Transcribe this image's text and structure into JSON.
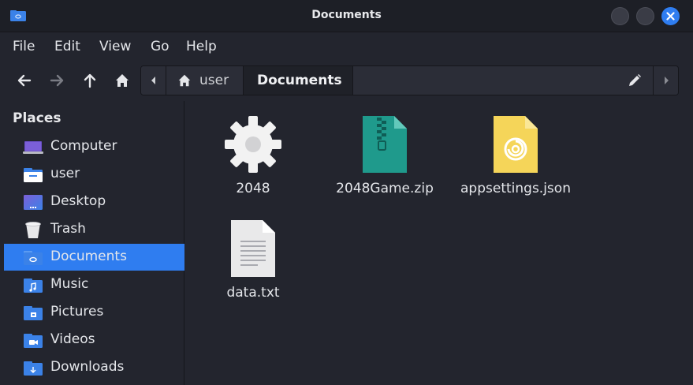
{
  "window": {
    "title": "Documents"
  },
  "menu": [
    "File",
    "Edit",
    "View",
    "Go",
    "Help"
  ],
  "path": {
    "home": "user",
    "current": "Documents"
  },
  "sidebar": {
    "heading": "Places",
    "items": [
      {
        "label": "Computer",
        "icon": "computer-icon"
      },
      {
        "label": "user",
        "icon": "home-folder-icon"
      },
      {
        "label": "Desktop",
        "icon": "desktop-folder-icon"
      },
      {
        "label": "Trash",
        "icon": "trash-icon"
      },
      {
        "label": "Documents",
        "icon": "documents-folder-icon",
        "active": true
      },
      {
        "label": "Music",
        "icon": "music-folder-icon"
      },
      {
        "label": "Pictures",
        "icon": "pictures-folder-icon"
      },
      {
        "label": "Videos",
        "icon": "videos-folder-icon"
      },
      {
        "label": "Downloads",
        "icon": "downloads-folder-icon"
      }
    ]
  },
  "files": [
    {
      "name": "2048",
      "icon": "executable-gear-icon"
    },
    {
      "name": "2048Game.zip",
      "icon": "zip-archive-icon"
    },
    {
      "name": "appsettings.json",
      "icon": "json-file-icon"
    },
    {
      "name": "data.txt",
      "icon": "text-file-icon"
    }
  ],
  "colors": {
    "accent": "#2f7df0",
    "background": "#23252e",
    "titlebar": "#1d1f26"
  }
}
